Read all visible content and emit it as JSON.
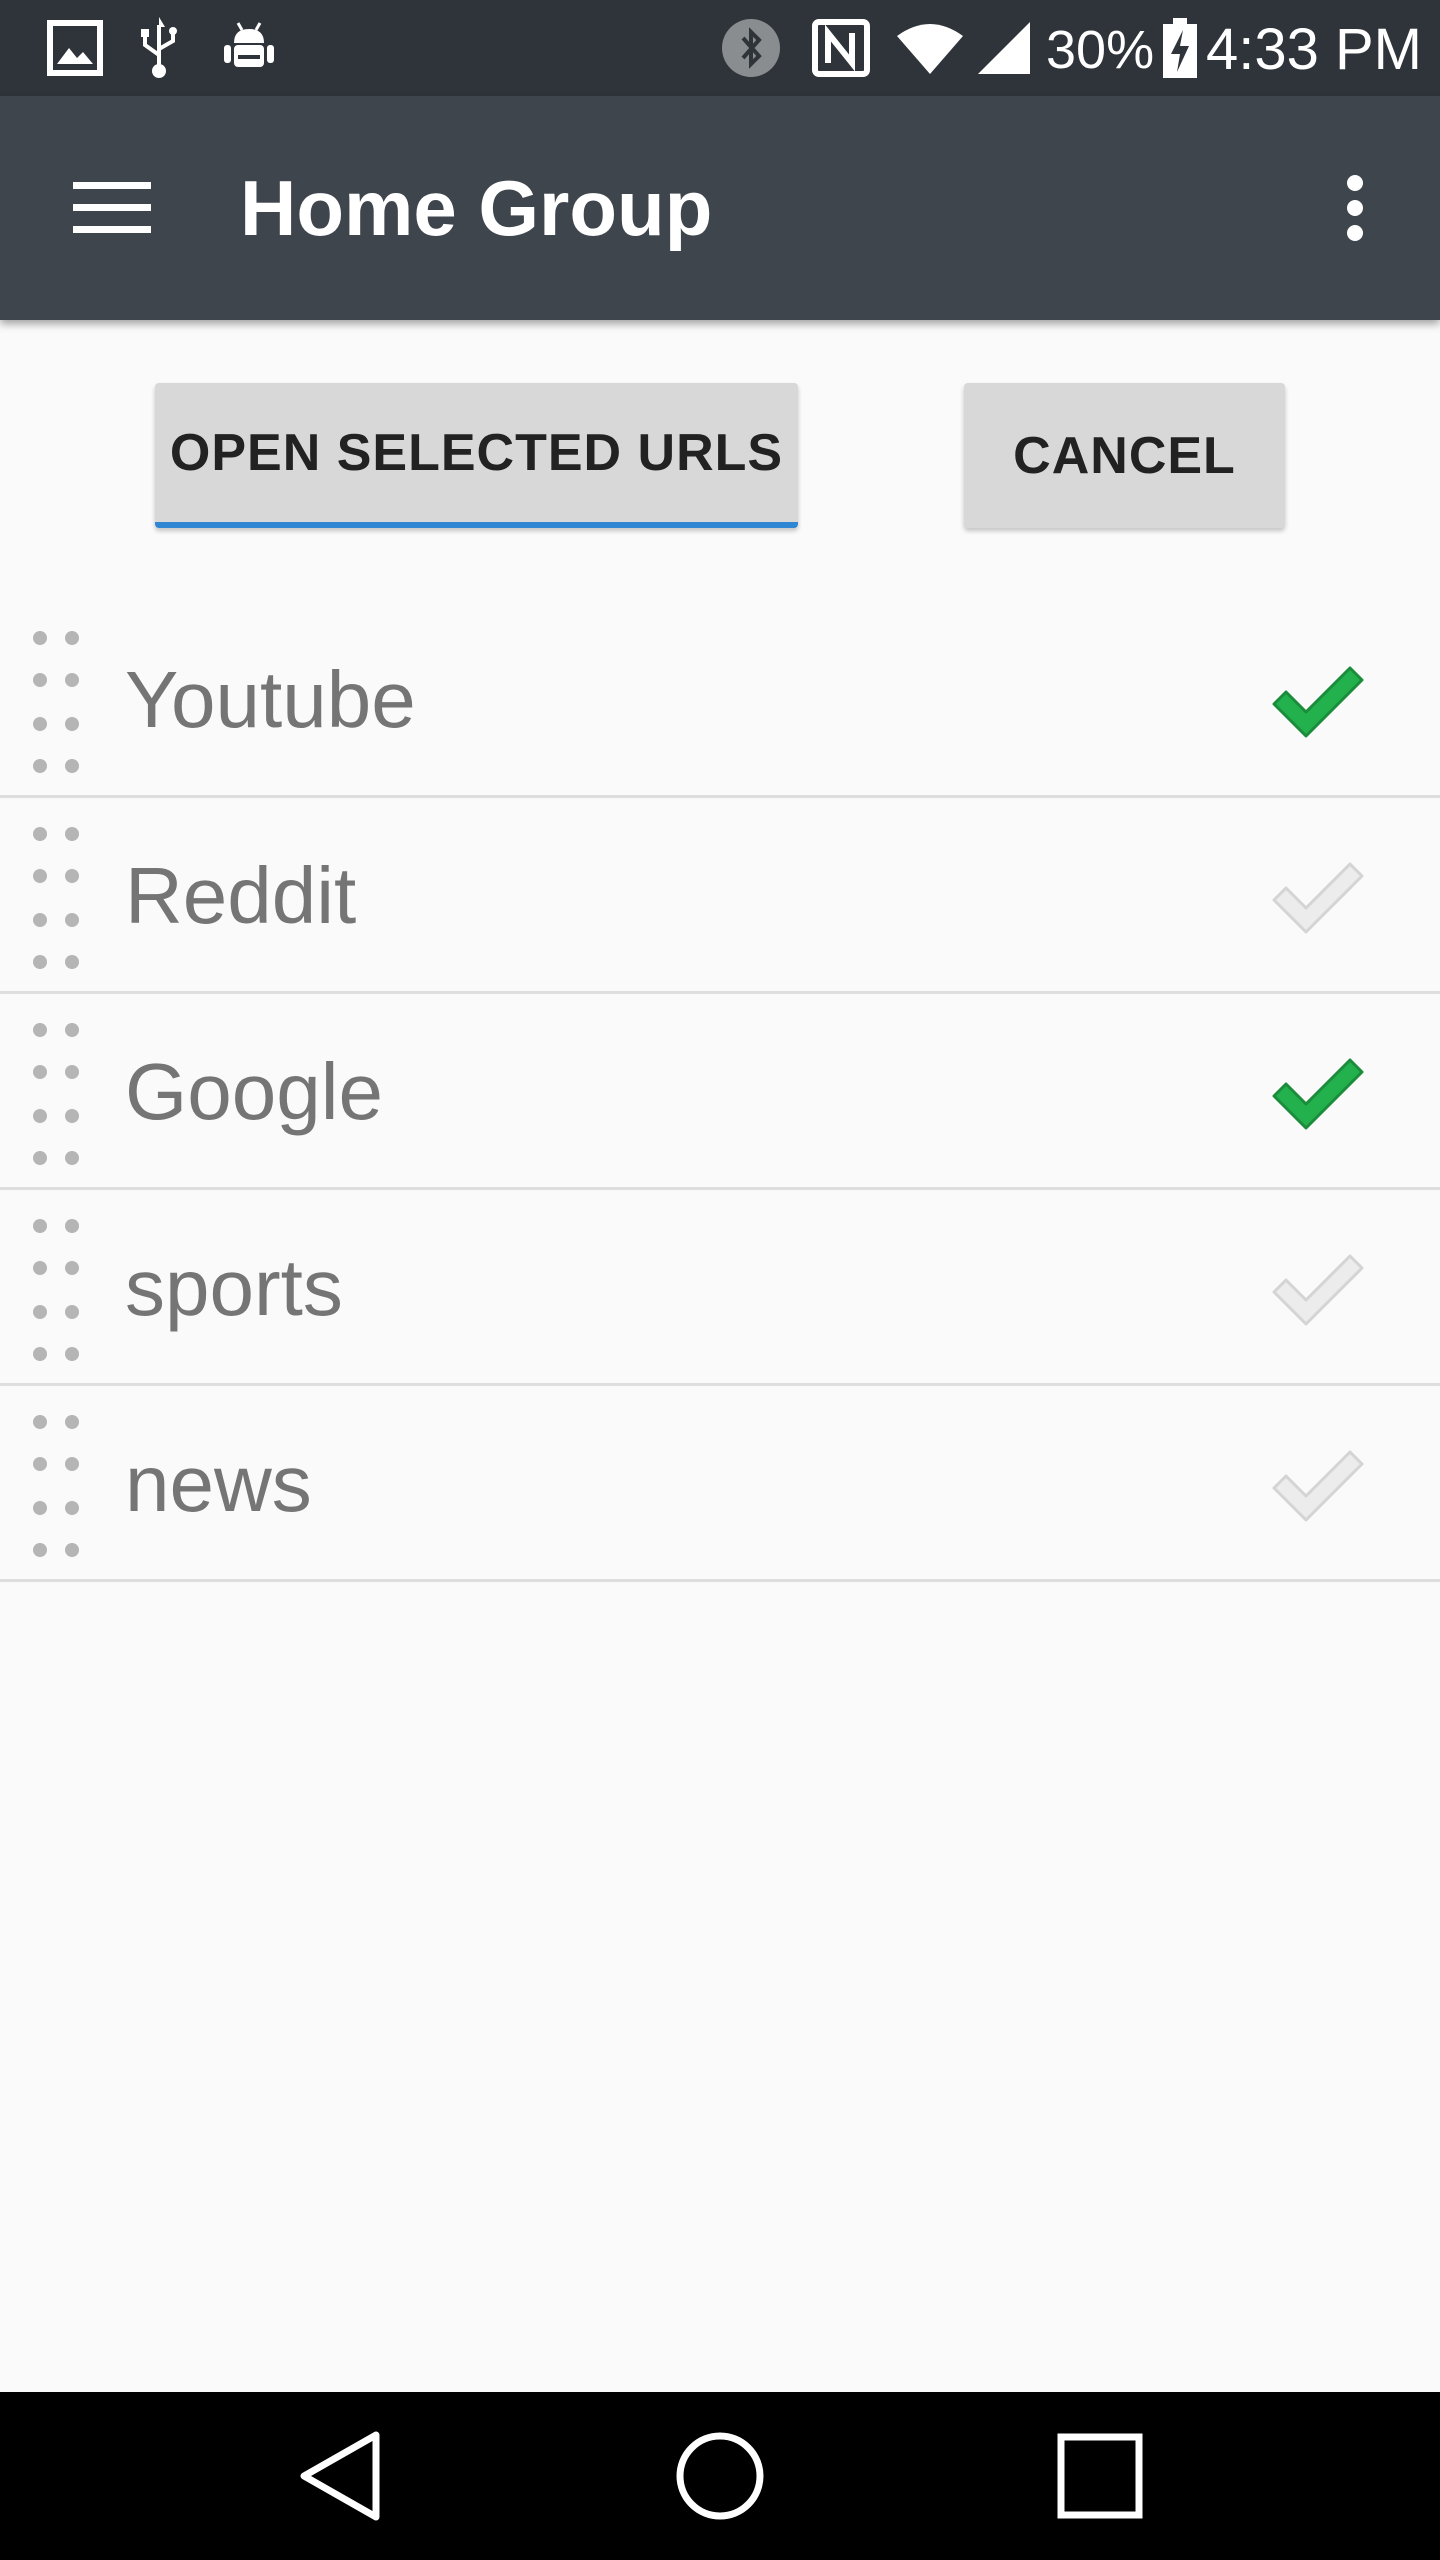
{
  "status_bar": {
    "icons": [
      "image-icon",
      "usb-icon",
      "android-debug-icon",
      "bluetooth-icon",
      "nfc-icon",
      "wifi-icon",
      "cell-signal-icon",
      "battery-charging-icon"
    ],
    "battery_percent": "30%",
    "time": "4:33 PM"
  },
  "app_bar": {
    "title": "Home Group",
    "menu_icon": "hamburger-menu-icon",
    "overflow_icon": "more-vert-icon"
  },
  "actions": {
    "open_label": "OPEN SELECTED URLS",
    "cancel_label": "CANCEL"
  },
  "list": {
    "items": [
      {
        "label": "Youtube",
        "checked": true
      },
      {
        "label": "Reddit",
        "checked": false
      },
      {
        "label": "Google",
        "checked": true
      },
      {
        "label": "sports",
        "checked": false
      },
      {
        "label": "news",
        "checked": false
      }
    ]
  },
  "colors": {
    "status_bar": "#2f343a",
    "app_bar": "#3f454d",
    "check_on": "#22b14c",
    "check_off": "#e0e0e0",
    "button_underline": "#2f86d2"
  },
  "nav_bar": {
    "icons": [
      "back-icon",
      "home-icon",
      "recents-icon"
    ]
  }
}
